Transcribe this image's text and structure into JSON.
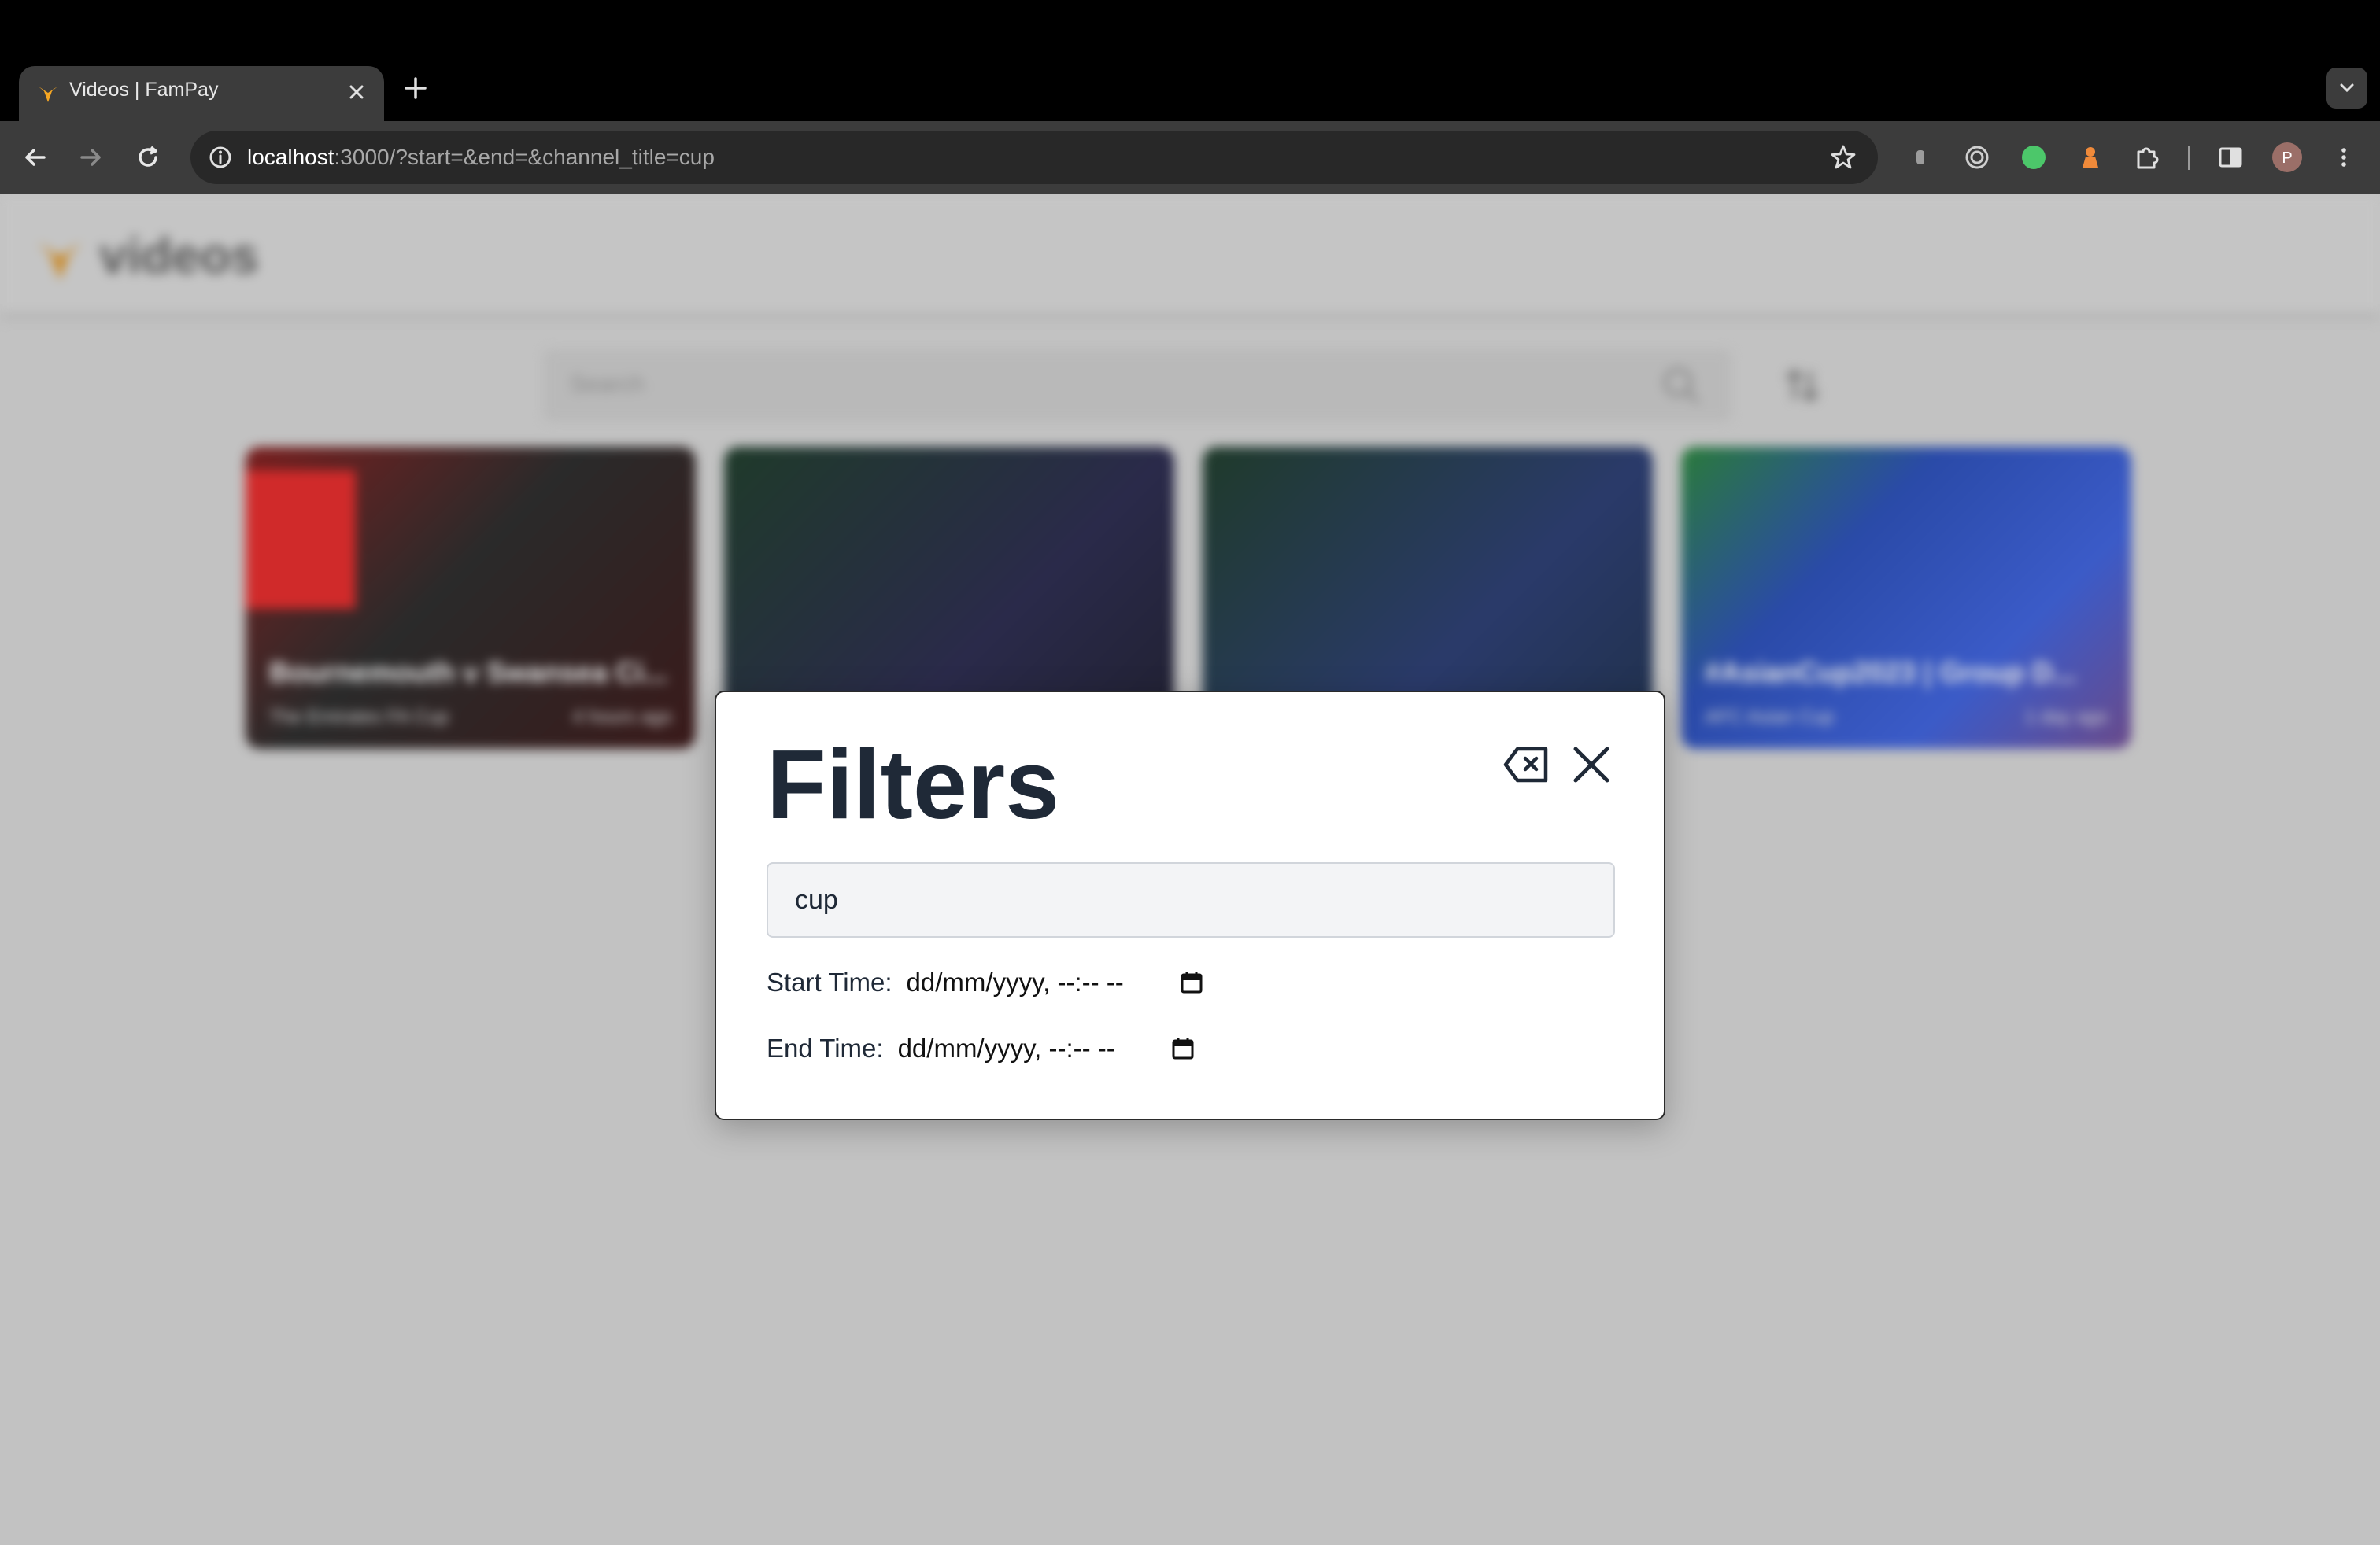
{
  "browser": {
    "tab_title": "Videos | FamPay",
    "url_host": "localhost",
    "url_rest": ":3000/?start=&end=&channel_title=cup",
    "profile_initial": "P"
  },
  "app": {
    "title": "videos",
    "search_placeholder": "Search"
  },
  "cards": [
    {
      "title": "Bournemouth v Swansea Ci...",
      "channel": "The Emirates FA Cup",
      "age": "4 hours ago"
    },
    {
      "title": "",
      "channel": "",
      "age": ""
    },
    {
      "title": "",
      "channel": "",
      "age": ""
    },
    {
      "title": "#AsianCup2023 | Group D...",
      "channel": "AFC Asian Cup",
      "age": "1 day ago"
    }
  ],
  "filters_modal": {
    "title": "Filters",
    "query_value": "cup",
    "start_label": "Start Time:",
    "start_value": "dd/mm/yyyy, --:-- --",
    "end_label": "End Time:",
    "end_value": "dd/mm/yyyy, --:-- --"
  },
  "colors": {
    "overlay_bg": "#c2c2c2",
    "modal_title": "#1f2937",
    "brand_accent": "#f5a623"
  }
}
